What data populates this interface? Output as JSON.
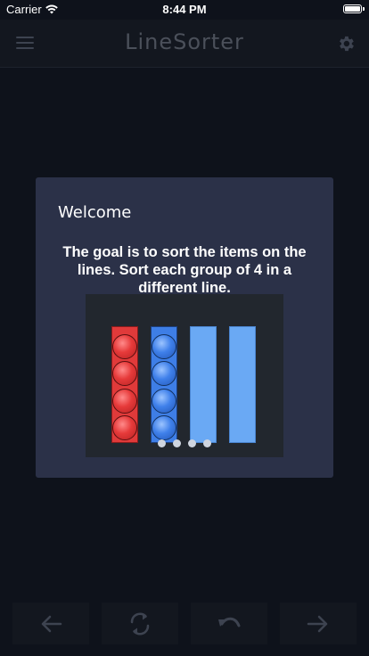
{
  "status_bar": {
    "carrier": "Carrier",
    "time": "8:44 PM",
    "icons": [
      "wifi-icon",
      "battery-icon"
    ]
  },
  "navbar": {
    "title": "LineSorter",
    "left_icon": "menu-icon",
    "right_icon": "gear-icon"
  },
  "modal": {
    "title": "Welcome",
    "text": "The goal is to sort the items on the lines. Sort each group of 4 in a different line.",
    "preview": {
      "tubes": [
        {
          "color": "red",
          "balls": 4
        },
        {
          "color": "blue",
          "balls": 4
        },
        {
          "color": "lightblue",
          "balls": 0
        },
        {
          "color": "lightblue",
          "balls": 0
        }
      ],
      "page_dots": 4
    }
  },
  "toolbar": {
    "buttons": [
      "arrow-left-icon",
      "refresh-icon",
      "undo-icon",
      "arrow-right-icon"
    ]
  },
  "colors": {
    "background": "#0e121b",
    "modal": "#2b3148",
    "red_ball": "#e03a3a",
    "blue_ball": "#3e7ee6",
    "empty_tube": "#6aa9f4"
  }
}
